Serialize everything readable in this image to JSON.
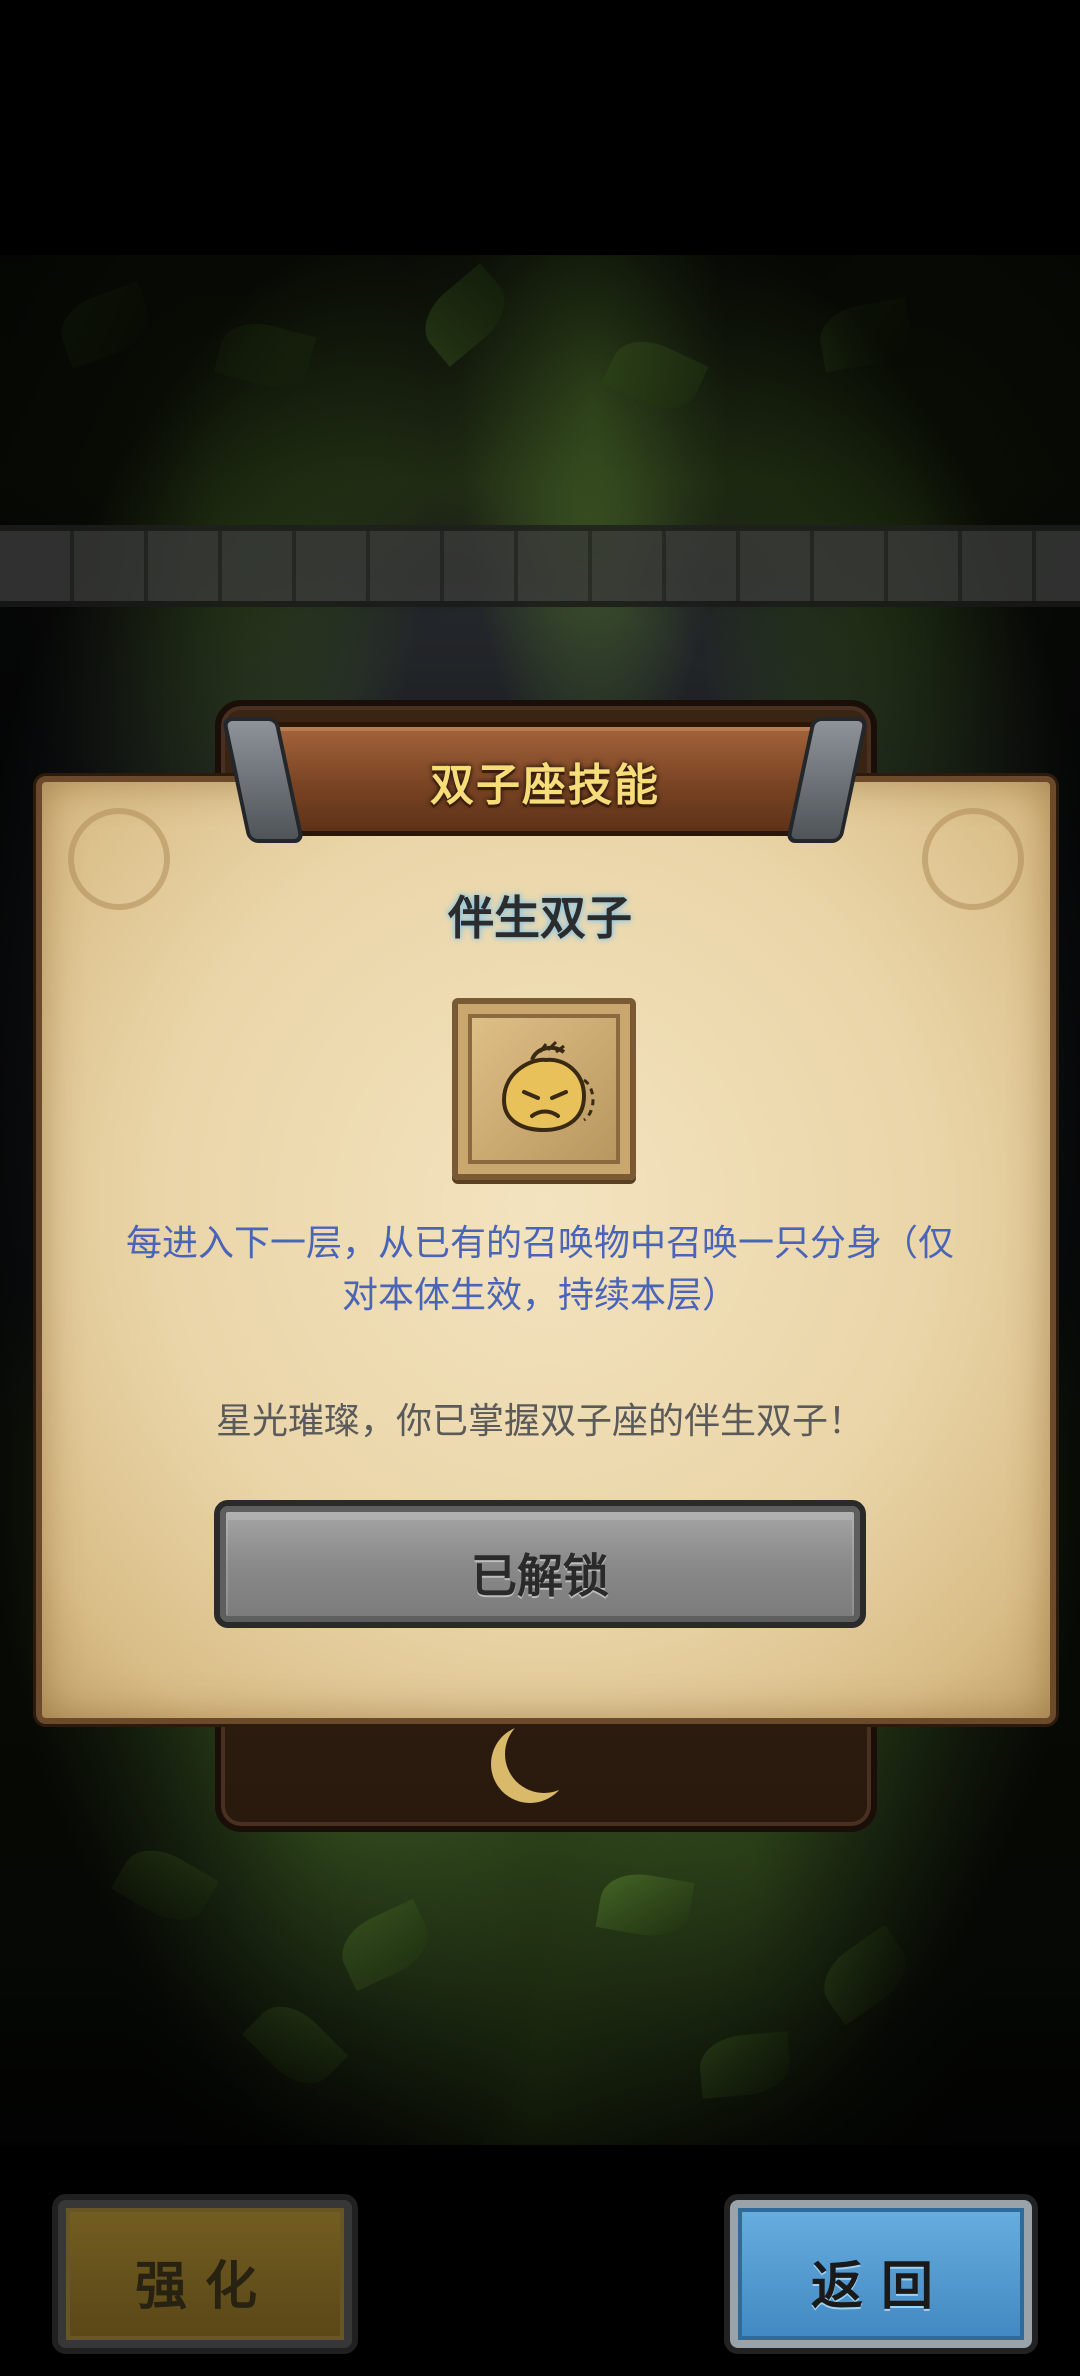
{
  "dialog": {
    "title": "双子座技能",
    "skill_name": "伴生双子",
    "skill_icon": "angry-dumpling-icon",
    "description": "每进入下一层，从已有的召唤物中召唤一只分身（仅对本体生效，持续本层）",
    "flavor_text": "星光璀璨，你已掌握双子座的伴生双子！",
    "status_button_label": "已解锁"
  },
  "bottom_bar": {
    "enhance_label": "强化",
    "back_label": "返回"
  },
  "colors": {
    "description_blue": "#4a64b8",
    "title_gold": "#f7dc7a",
    "parchment": "#ead5a8",
    "back_button_blue": "#4f94c9"
  }
}
